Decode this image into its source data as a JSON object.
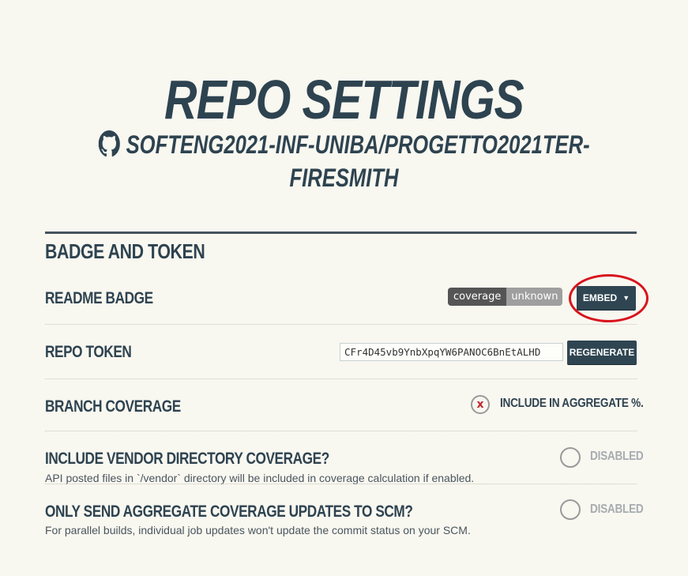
{
  "header": {
    "title": "REPO SETTINGS",
    "repo_name_line1": "SOFTENG2021-INF-UNIBA/PROGETTO2021TER-",
    "repo_name_line2": "FIRESMITH",
    "repo_icon": "github-icon"
  },
  "section": {
    "title": "BADGE AND TOKEN"
  },
  "readme_badge": {
    "label": "README BADGE",
    "badge_left": "coverage",
    "badge_right": "unknown",
    "embed_label": "EMBED",
    "embed_caret": "▼"
  },
  "repo_token": {
    "label": "REPO TOKEN",
    "value": "CFr4D45vb9YnbXpqYW6PANOC6BnEtALHD",
    "regenerate_label": "REGENERATE"
  },
  "branch_coverage": {
    "label": "BRANCH COVERAGE",
    "toggle_mark": "x",
    "toggle_label": "INCLUDE IN AGGREGATE %."
  },
  "vendor_coverage": {
    "label": "INCLUDE VENDOR DIRECTORY COVERAGE?",
    "description": "API posted files in `/vendor` directory will be included in coverage calculation if enabled.",
    "toggle_label": "DISABLED"
  },
  "aggregate_updates": {
    "label": "ONLY SEND AGGREGATE COVERAGE UPDATES TO SCM?",
    "description": "For parallel builds, individual job updates won't update the commit status on your SCM.",
    "toggle_label": "DISABLED"
  },
  "colors": {
    "background": "#f8f7f0",
    "heading": "#2e4350",
    "button_dark": "#2f4552",
    "highlight_ring": "#d8141c",
    "x_mark": "#c0282d"
  }
}
